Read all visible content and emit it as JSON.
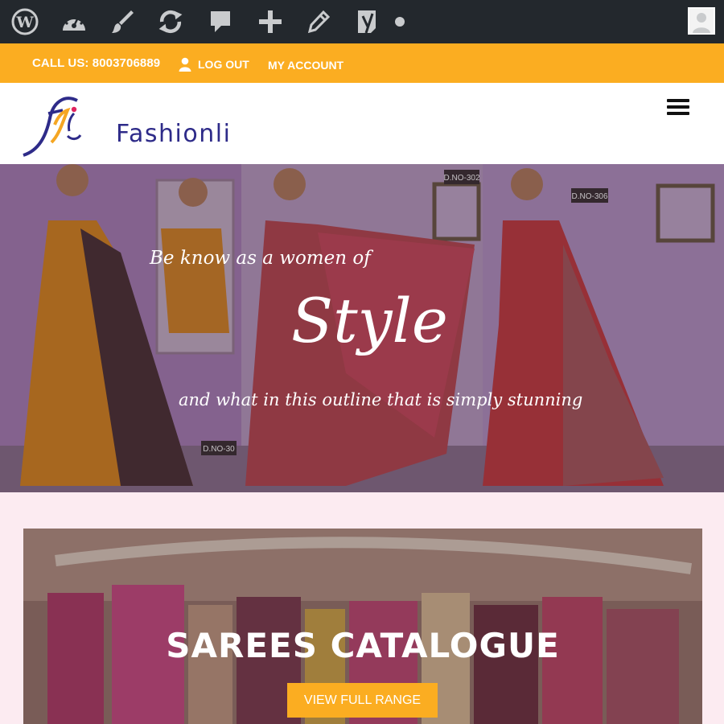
{
  "admin_bar": {
    "icons": [
      "wordpress-icon",
      "dashboard-icon",
      "customize-brush-icon",
      "updates-icon",
      "comments-icon",
      "new-content-icon",
      "edit-icon",
      "yoast-seo-icon",
      "status-dot-icon",
      "user-avatar-icon"
    ]
  },
  "top_bar": {
    "call_text": "CALL US: 8003706889",
    "logout_label": "LOG OUT",
    "account_label": "MY ACCOUNT",
    "color": "#fbad21"
  },
  "header": {
    "brand": "Fashionli",
    "brand_color": "#2e2b89",
    "menu_icon": "hamburger-menu-icon"
  },
  "hero": {
    "line1": "Be know as a women of",
    "headline": "Style",
    "line3": "and what in this outline that is simply stunning",
    "tags": [
      "D.NO-302",
      "D.NO-306",
      "D.NO-30"
    ]
  },
  "catalogue": {
    "title": "SAREES CATALOGUE",
    "button_label": "VIEW FULL RANGE"
  }
}
